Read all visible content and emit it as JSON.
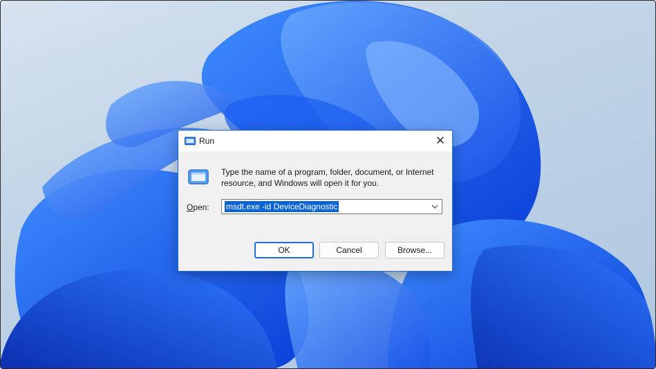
{
  "dialog": {
    "title": "Run",
    "description": "Type the name of a program, folder, document, or Internet resource, and Windows will open it for you.",
    "open_label_prefix": "",
    "open_label_hotkey": "O",
    "open_label_rest": "pen:",
    "open_value": "msdt.exe -id DeviceDiagnostic",
    "buttons": {
      "ok": "OK",
      "cancel": "Cancel",
      "browse": "Browse..."
    }
  },
  "colors": {
    "accent": "#1f6fd1",
    "selection": "#0a64d6",
    "highlight": "#e0463e"
  },
  "icons": {
    "title": "run-icon",
    "body": "run-icon",
    "close": "close-icon",
    "dropdown": "chevron-down-icon"
  }
}
